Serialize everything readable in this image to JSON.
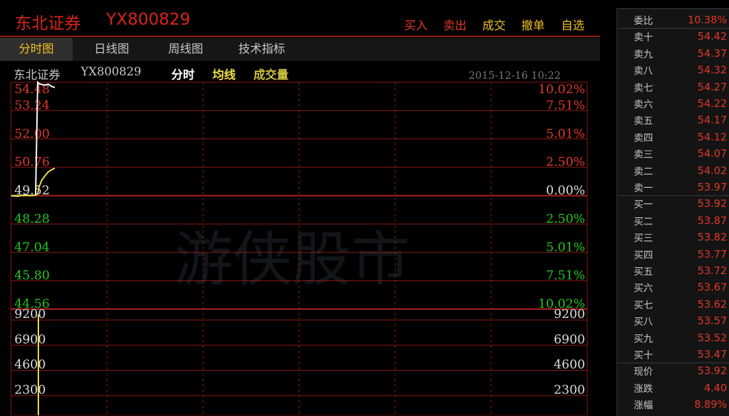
{
  "header": {
    "stock_name": "东北证券",
    "stock_code": "YX800829",
    "buttons": [
      "买入",
      "卖出",
      "成交",
      "撤单",
      "自选"
    ]
  },
  "tabs": [
    {
      "label": "分时图",
      "active": true
    },
    {
      "label": "日线图",
      "active": false
    },
    {
      "label": "周线图",
      "active": false
    },
    {
      "label": "技术指标",
      "active": false
    }
  ],
  "info": {
    "name": "东北证券",
    "code": "YX800829",
    "mode": "分时",
    "avg_line": "均线",
    "volume": "成交量",
    "datetime": "2015-12-16 10:22"
  },
  "watermark": "游侠股市",
  "chart": {
    "price_labels": [
      "54.48",
      "53.24",
      "52.00",
      "50.76",
      "49.52",
      "48.28",
      "47.04",
      "45.80",
      "44.56"
    ],
    "pct_labels": [
      "10.02%",
      "7.51%",
      "5.01%",
      "2.50%",
      "0.00%",
      "2.50%",
      "5.01%",
      "7.51%",
      "10.02%"
    ],
    "volume_labels": [
      "9200",
      "6900",
      "4600",
      "2300"
    ],
    "colors": {
      "up": "#e03828",
      "down": "#1ec81e",
      "flat": "#dddddd",
      "avg": "#f0e040",
      "grid": "#8b1a14"
    }
  },
  "chart_data": {
    "type": "line",
    "title": "",
    "price_axis": {
      "ylim": [
        44.56,
        54.48
      ],
      "ticks": [
        54.48,
        53.24,
        52.0,
        50.76,
        49.52,
        48.28,
        47.04,
        45.8,
        44.56
      ],
      "base": 49.52
    },
    "series": [
      {
        "name": "分时",
        "values": [
          49.52,
          49.5,
          49.55,
          49.53,
          49.55,
          54.48,
          54.42,
          54.38,
          54.35,
          54.4,
          54.3,
          54.25
        ]
      },
      {
        "name": "均线",
        "values": [
          49.52,
          49.52,
          49.53,
          49.53,
          49.54,
          49.6,
          49.9,
          50.2,
          50.4,
          50.55,
          50.65,
          50.72
        ]
      }
    ],
    "volume_axis": {
      "ylim": [
        0,
        9200
      ],
      "ticks": [
        9200,
        6900,
        4600,
        2300
      ]
    },
    "volume_values": [
      9200
    ]
  },
  "orderbook": {
    "ratio": {
      "label": "委比",
      "value": "10.38%"
    },
    "sells": [
      {
        "label": "卖十",
        "value": "54.42"
      },
      {
        "label": "卖九",
        "value": "54.37"
      },
      {
        "label": "卖八",
        "value": "54.32"
      },
      {
        "label": "卖七",
        "value": "54.27"
      },
      {
        "label": "卖六",
        "value": "54.22"
      },
      {
        "label": "卖五",
        "value": "54.17"
      },
      {
        "label": "卖四",
        "value": "54.12"
      },
      {
        "label": "卖三",
        "value": "54.07"
      },
      {
        "label": "卖二",
        "value": "54.02"
      },
      {
        "label": "卖一",
        "value": "53.97"
      }
    ],
    "buys": [
      {
        "label": "买一",
        "value": "53.92"
      },
      {
        "label": "买二",
        "value": "53.87"
      },
      {
        "label": "买三",
        "value": "53.82"
      },
      {
        "label": "买四",
        "value": "53.77"
      },
      {
        "label": "买五",
        "value": "53.72"
      },
      {
        "label": "买六",
        "value": "53.67"
      },
      {
        "label": "买七",
        "value": "53.62"
      },
      {
        "label": "买八",
        "value": "53.57"
      },
      {
        "label": "买九",
        "value": "53.52"
      },
      {
        "label": "买十",
        "value": "53.47"
      }
    ],
    "stats": [
      {
        "label": "现价",
        "value": "53.92"
      },
      {
        "label": "涨跌",
        "value": "4.40"
      },
      {
        "label": "涨幅",
        "value": "8.89%"
      }
    ]
  }
}
